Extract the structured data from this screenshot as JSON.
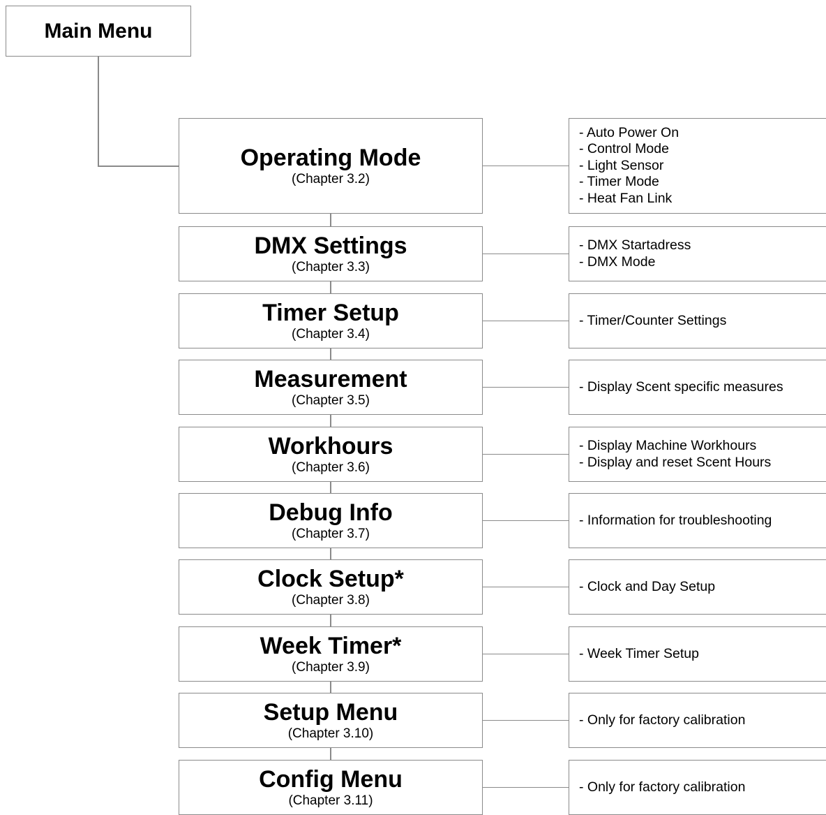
{
  "main_menu": {
    "title": "Main Menu"
  },
  "menus": [
    {
      "title": "Operating Mode",
      "chapter": "(Chapter 3.2)",
      "details": [
        "- Auto Power On",
        "- Control Mode",
        "- Light Sensor",
        "- Timer Mode",
        "- Heat Fan Link"
      ]
    },
    {
      "title": "DMX Settings",
      "chapter": "(Chapter 3.3)",
      "details": [
        "- DMX Startadress",
        "- DMX Mode"
      ]
    },
    {
      "title": "Timer Setup",
      "chapter": "(Chapter 3.4)",
      "details": [
        "- Timer/Counter Settings"
      ]
    },
    {
      "title": "Measurement",
      "chapter": "(Chapter 3.5)",
      "details": [
        "- Display Scent specific measures"
      ]
    },
    {
      "title": "Workhours",
      "chapter": "(Chapter 3.6)",
      "details": [
        "- Display Machine Workhours",
        "- Display and reset Scent Hours"
      ]
    },
    {
      "title": "Debug Info",
      "chapter": "(Chapter 3.7)",
      "details": [
        "- Information for troubleshooting"
      ]
    },
    {
      "title": "Clock Setup*",
      "chapter": "(Chapter 3.8)",
      "details": [
        "- Clock and Day Setup"
      ]
    },
    {
      "title": "Week Timer*",
      "chapter": "(Chapter 3.9)",
      "details": [
        "- Week Timer Setup"
      ]
    },
    {
      "title": "Setup Menu",
      "chapter": "(Chapter 3.10)",
      "details": [
        "- Only for factory calibration"
      ]
    },
    {
      "title": "Config Menu",
      "chapter": "(Chapter 3.11)",
      "details": [
        "- Only for factory calibration"
      ]
    }
  ]
}
